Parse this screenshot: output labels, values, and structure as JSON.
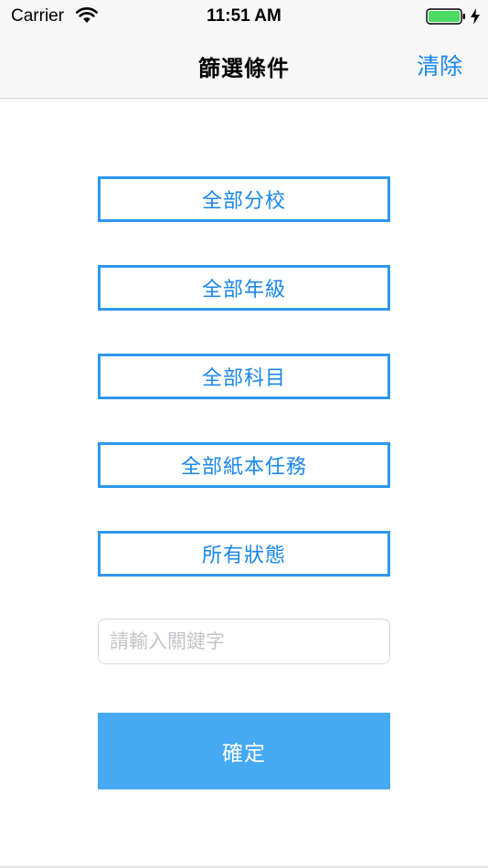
{
  "status_bar": {
    "carrier": "Carrier",
    "time": "11:51 AM",
    "icons": [
      "wifi-icon",
      "battery-icon",
      "charging-icon"
    ],
    "battery_color": "#4cd964"
  },
  "nav": {
    "title": "篩選條件",
    "clear_label": "清除"
  },
  "filters": {
    "branch": "全部分校",
    "grade": "全部年級",
    "subject": "全部科目",
    "paper_task": "全部紙本任務",
    "status": "所有狀態"
  },
  "search": {
    "placeholder": "請輸入關鍵字",
    "value": ""
  },
  "confirm_label": "確定",
  "colors": {
    "accent": "#1a87ea",
    "border": "#2f97ee",
    "confirm_bg": "#46aaf3"
  }
}
